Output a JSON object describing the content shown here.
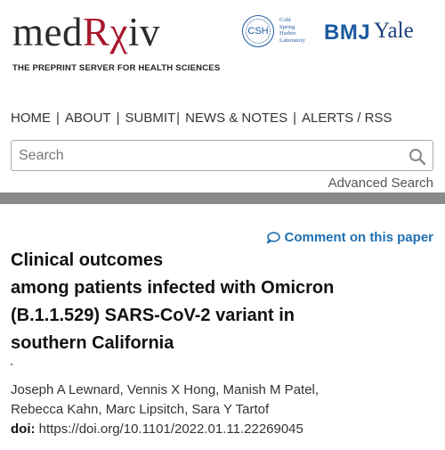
{
  "header": {
    "logo_prefix": "med",
    "logo_rx": "Rχ",
    "logo_suffix": "iv",
    "tagline": "THE PREPRINT SERVER FOR HEALTH SCIENCES",
    "partners": {
      "csh_mark": "CSH",
      "csh_lines": [
        "Cold",
        "Spring",
        "Harbor",
        "Laboratory"
      ],
      "bmj": "BMJ",
      "yale": "Yale"
    }
  },
  "nav": {
    "items": [
      "HOME",
      "ABOUT",
      "SUBMIT",
      "NEWS & NOTES",
      "ALERTS / RSS"
    ]
  },
  "search": {
    "placeholder": "Search",
    "advanced_label": "Advanced Search"
  },
  "article": {
    "comment_label": "Comment on this paper",
    "title_lines": [
      "Clinical outcomes",
      "among patients infected with Omicron",
      "(B.1.1.529) SARS-CoV-2 variant in",
      "southern California"
    ],
    "author_lines": [
      "Joseph A Lewnard, Vennis X Hong, Manish M Patel,",
      "Rebecca Kahn, Marc Lipsitch, Sara Y Tartof"
    ],
    "doi_label": "doi:",
    "doi_value": "https://doi.org/10.1101/2022.01.11.22269045"
  },
  "colors": {
    "brand_red": "#a8172b",
    "partner_blue": "#1c5a9f",
    "link_blue": "#1f6fb2",
    "divider_gray": "#8a8a8a"
  }
}
